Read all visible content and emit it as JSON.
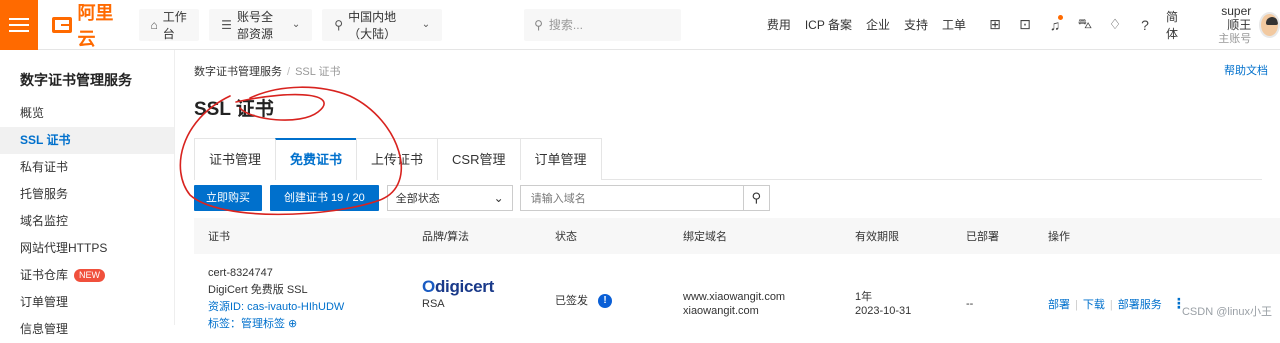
{
  "topbar": {
    "logo_text": "阿里云",
    "workbench": "工作台",
    "account_resources": "账号全部资源",
    "region": "中国内地（大陆）",
    "search_placeholder": "搜索...",
    "links": [
      "费用",
      "ICP 备案",
      "企业",
      "支持",
      "工单"
    ],
    "language": "简体",
    "user_name": "super顺王",
    "user_role": "主账号",
    "icons": [
      "grid-icon",
      "terminal-icon",
      "bell-icon",
      "cart-icon",
      "bulb-icon",
      "help-icon"
    ],
    "accent_color": "#ff6a00"
  },
  "sidebar": {
    "title": "数字证书管理服务",
    "items": [
      {
        "label": "概览"
      },
      {
        "label": "SSL 证书",
        "active": true
      },
      {
        "label": "私有证书"
      },
      {
        "label": "托管服务"
      },
      {
        "label": "域名监控"
      },
      {
        "label": "网站代理HTTPS"
      },
      {
        "label": "证书仓库",
        "badge": "NEW"
      },
      {
        "label": "订单管理"
      },
      {
        "label": "信息管理"
      }
    ]
  },
  "main": {
    "breadcrumb": [
      "数字证书管理服务",
      "SSL 证书"
    ],
    "help_link": "帮助文档",
    "title": "SSL 证书",
    "tabs": [
      {
        "label": "证书管理"
      },
      {
        "label": "免费证书",
        "active": true
      },
      {
        "label": "上传证书"
      },
      {
        "label": "CSR管理"
      },
      {
        "label": "订单管理"
      }
    ],
    "toolbar": {
      "buy_button": "立即购买",
      "create_button": "创建证书 19 / 20",
      "status_select": "全部状态",
      "domain_placeholder": "请输入域名"
    },
    "table": {
      "columns": [
        "证书",
        "品牌/算法",
        "状态",
        "绑定域名",
        "有效期限",
        "已部署",
        "操作"
      ],
      "rows": [
        {
          "cert_name": "cert-8324747",
          "cert_type": "DigiCert 免费版 SSL",
          "resource_id": "资源ID: cas-ivauto-HIhUDW",
          "extra": "标签：管理标签 ⊕",
          "brand_logo": "digicert",
          "algorithm": "RSA",
          "status": "已签发",
          "domains": [
            "www.xiaowangit.com",
            "xiaowangit.com"
          ],
          "validity": "1年",
          "expiry": "2023-10-31",
          "deployed": "--",
          "actions": [
            "部署",
            "下载",
            "部署服务"
          ]
        }
      ]
    }
  },
  "watermark": "CSDN @linux小王"
}
